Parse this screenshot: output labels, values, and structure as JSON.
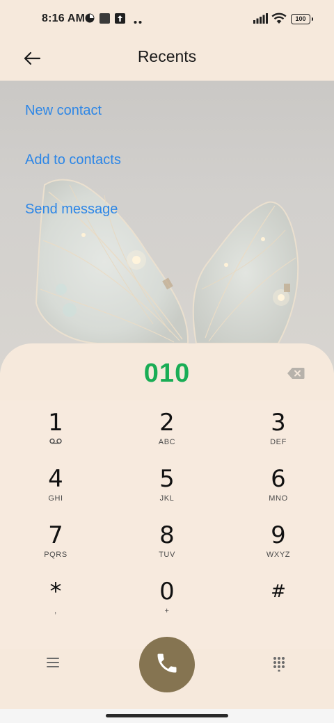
{
  "status_bar": {
    "time": "8:16 AM",
    "battery": "100",
    "icons": [
      "signal-icon",
      "wifi-icon",
      "battery-icon",
      "notification-icons"
    ]
  },
  "header": {
    "title": "Recents",
    "back_icon": "arrow-left-icon"
  },
  "actions": [
    {
      "label": "New contact"
    },
    {
      "label": "Add to contacts"
    },
    {
      "label": "Send message"
    }
  ],
  "dialer": {
    "number": "010",
    "backspace_icon": "backspace-icon",
    "keys": [
      {
        "digit": "1",
        "letters": ""
      },
      {
        "digit": "2",
        "letters": "ABC"
      },
      {
        "digit": "3",
        "letters": "DEF"
      },
      {
        "digit": "4",
        "letters": "GHI"
      },
      {
        "digit": "5",
        "letters": "JKL"
      },
      {
        "digit": "6",
        "letters": "MNO"
      },
      {
        "digit": "7",
        "letters": "PQRS"
      },
      {
        "digit": "8",
        "letters": "TUV"
      },
      {
        "digit": "9",
        "letters": "WXYZ"
      },
      {
        "digit": "*",
        "letters": ","
      },
      {
        "digit": "0",
        "letters": "+"
      },
      {
        "digit": "#",
        "letters": ""
      }
    ],
    "voicemail_icon": "voicemail-icon",
    "menu_icon": "menu-icon",
    "call_icon": "phone-icon",
    "keypad_icon": "dialpad-icon"
  },
  "colors": {
    "accent_link": "#2d86e6",
    "number_green": "#19ad55",
    "call_button": "#857451",
    "panel_bg": "#f6e9dc"
  }
}
